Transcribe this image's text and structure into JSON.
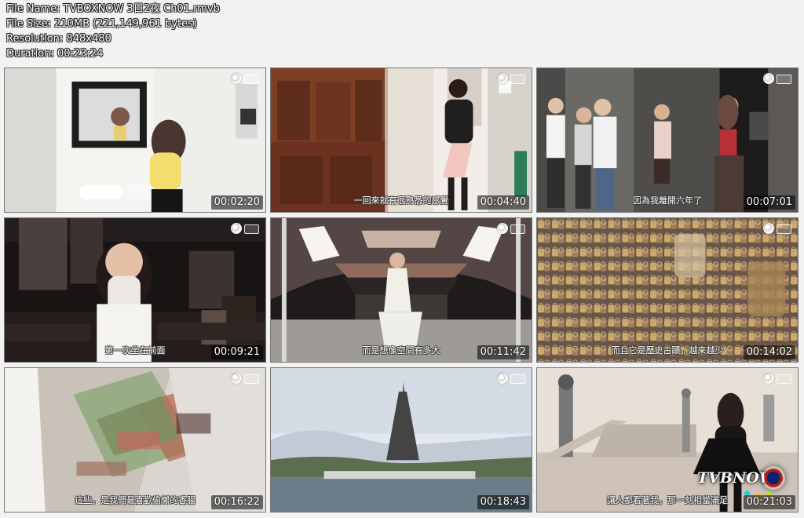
{
  "header": {
    "file_name": "File Name: TVBOXNOW 3日2夜 Ch01.rmvb",
    "file_size": "File Size: 210MB (221,149,961 bytes)",
    "resolution": "Resolution: 848x480",
    "duration": "Duration: 00:23:24"
  },
  "thumbnails": [
    {
      "time": "00:02:20",
      "subtitle": "",
      "scene": "bathroom-mirror"
    },
    {
      "time": "00:04:40",
      "subtitle": "一回來就有很熟悉的感覺",
      "scene": "street-doorway"
    },
    {
      "time": "00:07:01",
      "subtitle": "因為我離開六年了",
      "scene": "group-entrance"
    },
    {
      "time": "00:09:21",
      "subtitle": "第一次坐在前面",
      "scene": "theater-seat"
    },
    {
      "time": "00:11:42",
      "subtitle": "而是想像空間有多大",
      "scene": "stage-hall"
    },
    {
      "time": "00:14:02",
      "subtitle": "而且它是歷史古蹟，越來越少",
      "scene": "love-locks"
    },
    {
      "time": "00:16:22",
      "subtitle": "這些，是我們最喜歡偷懶的香腸",
      "scene": "market-street"
    },
    {
      "time": "00:18:43",
      "subtitle": "",
      "scene": "eiffel-tower"
    },
    {
      "time": "00:21:03",
      "subtitle": "讓人都看著我，那一刻相當滿足",
      "scene": "bridge-statue"
    }
  ],
  "watermark": {
    "text": "TVBNOW"
  },
  "colors": {
    "background": "#f2f2f2",
    "header_text": "#ffffff",
    "timestamp_bg": "rgba(0,0,0,0.55)",
    "accent_blue": "#0b2470",
    "accent_red": "#b11b1b"
  }
}
